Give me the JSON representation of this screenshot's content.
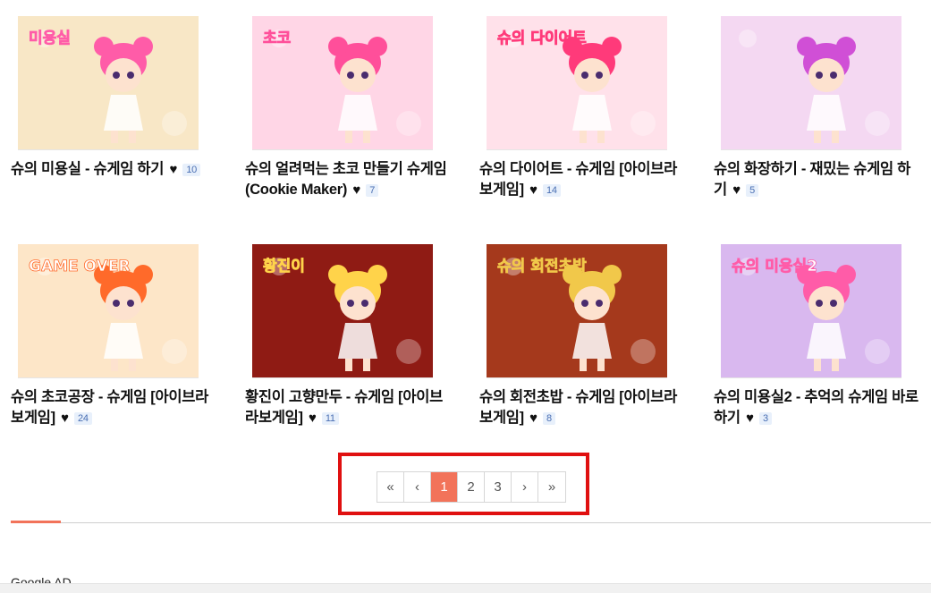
{
  "games": [
    {
      "title": "슈의 미용실 - 슈게임 하기",
      "count": "10",
      "thumb_text": "미용실",
      "bg": "#f8e7c6",
      "accent": "#ff5ca8"
    },
    {
      "title": "슈의 얼려먹는 초코 만들기 슈게임 (Cookie Maker)",
      "count": "7",
      "thumb_text": "초코",
      "bg": "#ffd6e6",
      "accent": "#ff4f9a"
    },
    {
      "title": "슈의 다이어트 - 슈게임 [아이브라 보게임]",
      "count": "14",
      "thumb_text": "슈의 다이어트",
      "bg": "#ffe1ea",
      "accent": "#ff3a7a"
    },
    {
      "title": "슈의 화장하기 - 재밌는 슈게임 하기",
      "count": "5",
      "thumb_text": "",
      "bg": "#f4d8f2",
      "accent": "#d04fd6"
    },
    {
      "title": "슈의 초코공장 - 슈게임 [아이브라 보게임]",
      "count": "24",
      "thumb_text": "GAME OVER",
      "bg": "#fde6c8",
      "accent": "#ff6a2a"
    },
    {
      "title": "황진이 고향만두 - 슈게임 [아이브라보게임]",
      "count": "11",
      "thumb_text": "황진이",
      "bg": "#8f1b14",
      "accent": "#ffd34a"
    },
    {
      "title": "슈의 회전초밥 - 슈게임 [아이브라 보게임]",
      "count": "8",
      "thumb_text": "슈의 회전초밥",
      "bg": "#a5391c",
      "accent": "#f1c84a"
    },
    {
      "title": "슈의 미용실2 - 추억의 슈게임 바로하기",
      "count": "3",
      "thumb_text": "슈의 미용실2",
      "bg": "#d9b8ef",
      "accent": "#ff5ca8"
    }
  ],
  "pagination": {
    "first": "«",
    "prev": "‹",
    "pages": [
      "1",
      "2",
      "3"
    ],
    "current": "1",
    "next": "›",
    "last": "»"
  },
  "ad_label": "Google AD",
  "colors": {
    "accent": "#f2735a",
    "highlight_box": "#e01010"
  }
}
